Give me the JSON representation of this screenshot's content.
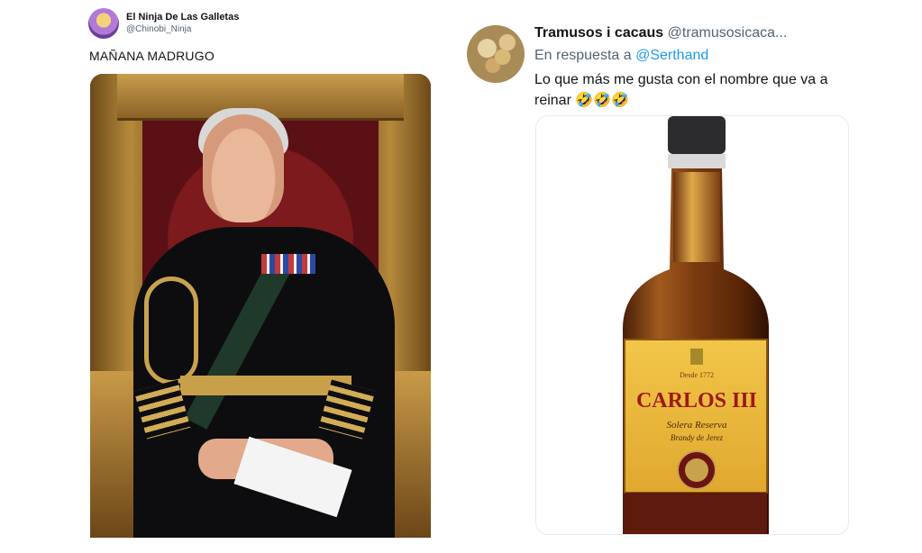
{
  "left_tweet": {
    "user_name": "El Ninja De Las Galletas",
    "handle": "@Chinobi_Ninja",
    "text": "MAÑANA MADRUGO"
  },
  "right_tweet": {
    "user_name": "Tramusos i cacaus",
    "handle": "@tramusosicaca...",
    "reply_prefix": "En respuesta a",
    "reply_to": "@Serthand",
    "text": "Lo que más me gusta con el nombre que va a reinar 🤣🤣🤣"
  },
  "bottle_label": {
    "since": "Desde 1772",
    "brand": "CARLOS III",
    "subtitle": "Solera Reserva",
    "kind": "Brandy de Jerez"
  }
}
